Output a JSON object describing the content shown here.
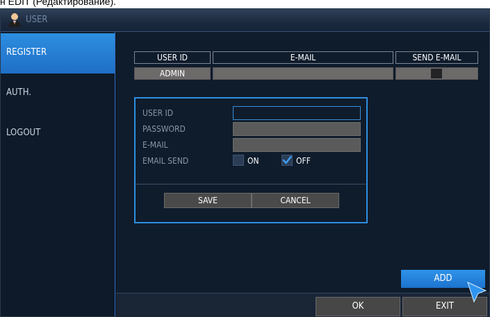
{
  "caption": "н EDIT (Редактирование).",
  "window": {
    "title": "USER",
    "icon": "user-icon"
  },
  "sidebar": {
    "items": [
      {
        "label": "REGISTER",
        "active": true
      },
      {
        "label": "AUTH.",
        "active": false
      },
      {
        "label": "LOGOUT",
        "active": false
      }
    ]
  },
  "table": {
    "headers": [
      "USER ID",
      "E-MAIL",
      "SEND E-MAIL"
    ],
    "rows": [
      {
        "user_id": "ADMIN",
        "email": "",
        "send_email": "toggle"
      }
    ]
  },
  "dialog": {
    "fields": [
      {
        "label": "USER ID",
        "value": ""
      },
      {
        "label": "PASSWORD",
        "value": ""
      },
      {
        "label": "E-MAIL",
        "value": ""
      }
    ],
    "email_send": {
      "label": "EMAIL SEND",
      "on_label": "ON",
      "off_label": "OFF",
      "selected": "OFF"
    },
    "save_label": "SAVE",
    "cancel_label": "CANCEL"
  },
  "actions": {
    "add_label": "ADD",
    "ok_label": "OK",
    "exit_label": "EXIT"
  },
  "colors": {
    "accent": "#2f8fe0",
    "background": "#0f1c2c",
    "field_gray": "#5a5a5a"
  }
}
